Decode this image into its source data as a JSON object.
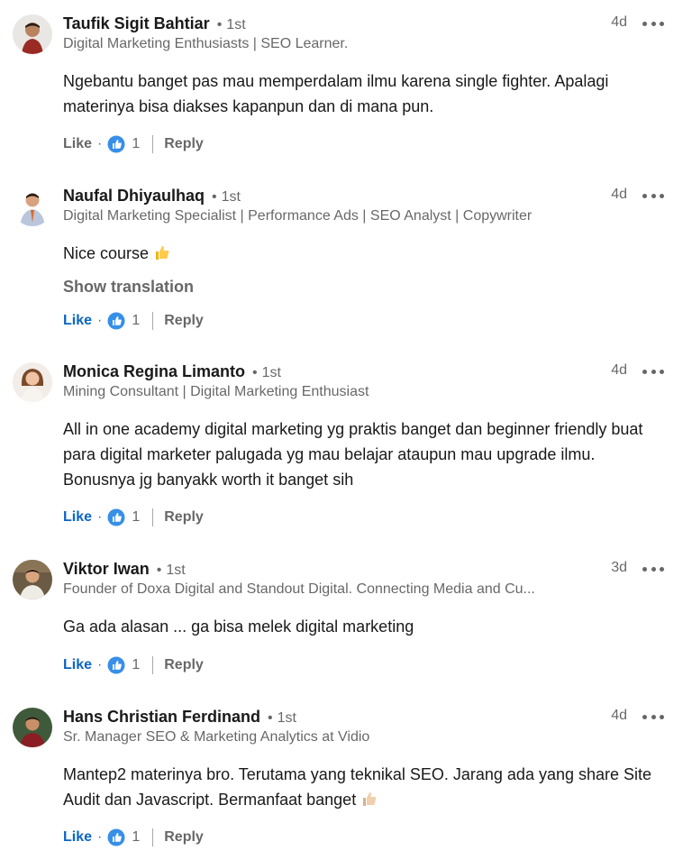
{
  "actions": {
    "like_label": "Like",
    "reply_label": "Reply",
    "separator": "·",
    "degree_dot": "•"
  },
  "colors": {
    "link_blue": "#0a66c2",
    "muted": "rgba(0,0,0,0.6)",
    "text": "rgba(0,0,0,0.9)"
  },
  "comments": [
    {
      "name": "Taufik Sigit Bahtiar",
      "degree": "1st",
      "headline": "Digital Marketing Enthusiasts | SEO Learner.",
      "time": "4d",
      "text": "Ngebantu banget pas mau memperdalam ilmu karena single fighter. Apalagi materinya bisa diakses kapanpun dan di mana pun.",
      "reactions": "1",
      "liked": false
    },
    {
      "name": "Naufal Dhiyaulhaq",
      "degree": "1st",
      "headline": "Digital Marketing Specialist | Performance Ads | SEO Analyst | Copywriter",
      "time": "4d",
      "text": "Nice course",
      "emoji": "thumbs-up-icon",
      "show_translation": "Show translation",
      "reactions": "1",
      "liked": true
    },
    {
      "name": "Monica Regina Limanto",
      "degree": "1st",
      "headline": "Mining Consultant | Digital Marketing Enthusiast",
      "time": "4d",
      "text": "All in one academy digital marketing yg praktis banget dan beginner friendly buat para digital marketer palugada yg mau belajar ataupun mau upgrade ilmu. Bonusnya jg banyakk worth it banget sih",
      "reactions": "1",
      "liked": true
    },
    {
      "name": "Viktor Iwan",
      "degree": "1st",
      "headline": "Founder of Doxa Digital and Standout Digital. Connecting Media and Cu...",
      "time": "3d",
      "text": "Ga ada alasan ... ga bisa melek digital marketing",
      "reactions": "1",
      "liked": true
    },
    {
      "name": "Hans Christian Ferdinand",
      "degree": "1st",
      "headline": "Sr. Manager SEO & Marketing Analytics at Vidio",
      "time": "4d",
      "text": "Mantep2 materinya bro. Terutama yang teknikal SEO. Jarang ada yang share Site Audit dan Javascript. Bermanfaat banget",
      "emoji": "thumbs-up-light-skin-icon",
      "reactions": "1",
      "liked": true
    }
  ]
}
